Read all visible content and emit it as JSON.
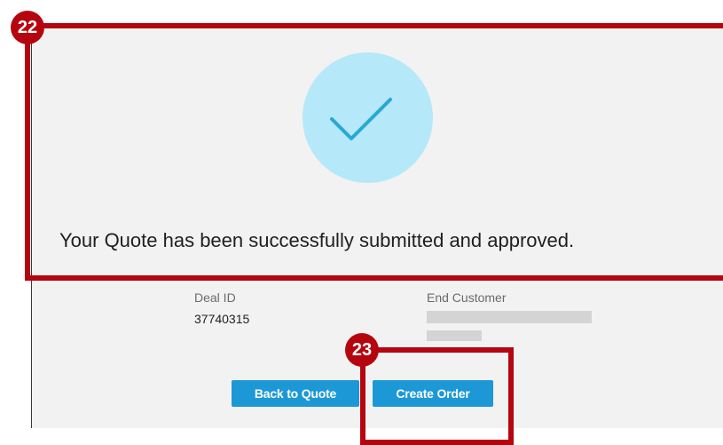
{
  "confirmation": {
    "message": "Your Quote has been successfully submitted and approved."
  },
  "details": {
    "deal_id_label": "Deal ID",
    "deal_id_value": "37740315",
    "end_customer_label": "End Customer"
  },
  "actions": {
    "back_label": "Back to Quote",
    "create_order_label": "Create Order"
  },
  "annotations": {
    "callout_22": "22",
    "callout_23": "23"
  },
  "colors": {
    "annotation_red": "#b5060f",
    "button_blue": "#1c98d6",
    "check_circle": "#b5e8f8",
    "check_stroke": "#29a8d6"
  }
}
